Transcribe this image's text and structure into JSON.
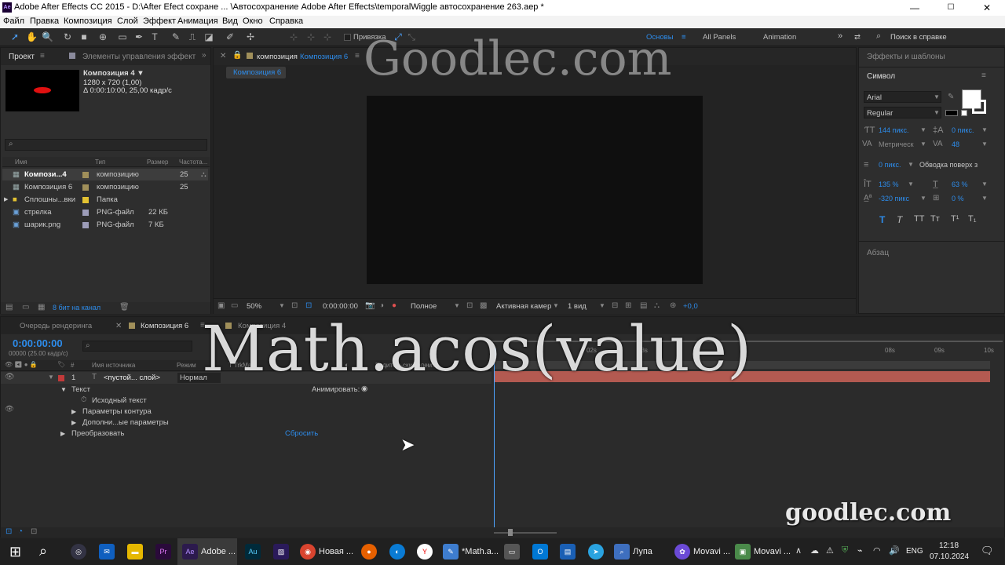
{
  "window": {
    "title": "Adobe After Effects CC 2015 - D:\\After Efect сохране ... \\Автосохранение Adobe After Effects\\temporalWiggle автосохранение 263.aep *",
    "logo": "Ae",
    "minimize": "—",
    "maximize": "☐",
    "close": "✕"
  },
  "menu": [
    "Файл",
    "Правка",
    "Композиция",
    "Слой",
    "Эффект",
    "Анимация",
    "Вид",
    "Окно",
    "Справка"
  ],
  "toolbar": {
    "snap_label": "Привязка",
    "workspaces": [
      "Основы",
      "All Panels",
      "Animation"
    ],
    "help_search": "Поиск в справке"
  },
  "project": {
    "tab": "Проект",
    "tab2": "Элементы управления эффект",
    "comp_name": "Композиция 4 ▼",
    "comp_size": "1280 x 720 (1,00)",
    "comp_duration": "Δ 0:00:10:00, 25,00 кадр/с",
    "search_placeholder": "",
    "columns": [
      "Имя",
      "Тип",
      "Размер",
      "Частота..."
    ],
    "items": [
      {
        "name": "Компози...4",
        "type": "композицию",
        "size": "",
        "rate": "25",
        "color": "#a08f5a"
      },
      {
        "name": "Композиция 6",
        "type": "композицию",
        "size": "",
        "rate": "25",
        "color": "#a08f5a"
      },
      {
        "name": "Сплошны...вки",
        "type": "Папка",
        "size": "",
        "rate": "",
        "color": "#e3c232"
      },
      {
        "name": "стрелка",
        "type": "PNG-файл",
        "size": "22 КБ",
        "rate": "",
        "color": "#9c9cb8"
      },
      {
        "name": "шарик.png",
        "type": "PNG-файл",
        "size": "7 КБ",
        "rate": "",
        "color": "#9c9cb8"
      }
    ],
    "bit_depth": "8 бит на канал"
  },
  "viewer": {
    "tab_prefix": "композиция",
    "tab_name": "Композиция 6",
    "breadcrumb": "Композиция 6",
    "zoom": "50%",
    "timecode": "0:00:00:00",
    "quality": "Полное",
    "camera": "Активная камер",
    "views": "1 вид",
    "exposure": "+0,0"
  },
  "watermark_top": "Goodlec.com",
  "watermark_bottom": "goodlec.com",
  "overlay_text": "Math.acos(value)",
  "right_panel": {
    "effects_tab": "Эффекты и шаблоны",
    "symbol_tab": "Символ",
    "font": "Arial",
    "style": "Regular",
    "size": "144 пикс.",
    "leading": "0 пикс.",
    "kerning": "Метрическ",
    "tracking": "48",
    "stroke": "0 пикс.",
    "stroke_mode": "Обводка поверх з",
    "vscale": "135 %",
    "hscale": "63 %",
    "baseline": "-320 пикс",
    "tsume": "0 %",
    "paragraph_tab": "Абзац",
    "styles": [
      "T",
      "T",
      "TT",
      "Tт",
      "T¹",
      "T₁"
    ]
  },
  "timeline": {
    "tabs": [
      "Очередь рендеринга",
      "Композиция 6",
      "Композиция 4"
    ],
    "timecode": "0:00:00:00",
    "frame_info": "00000 (25.00 кадр/с)",
    "col_source": "Имя источника",
    "col_mode": "Режим",
    "col_trkmat": "T TrkMat",
    "col_parent": "Родительский элем.",
    "layer_num": "1",
    "layer_name": "<пустой... слой>",
    "layer_mode": "Нормал",
    "text_group": "Текст",
    "animate": "Анимировать:",
    "source_text": "Исходный текст",
    "path_options": "Параметры контура",
    "more_options": "Дополни...ые параметры",
    "transform": "Преобразовать",
    "reset": "Сбросить",
    "ruler": [
      "02s",
      "03s",
      "08s",
      "09s",
      "10s"
    ]
  },
  "taskbar": {
    "apps": [
      {
        "label": "Adobe ...",
        "icon": "Ae",
        "color": "#2c1a4d"
      },
      {
        "label": "Новая ...",
        "icon": "chrome-icon",
        "color": "#d9442f"
      },
      {
        "label": "*Math.a...",
        "icon": "notepad-icon",
        "color": "#3e7dcf"
      },
      {
        "label": "Лупа",
        "icon": "magnifier-icon",
        "color": "#3e6fbf"
      },
      {
        "label": "Movavi ...",
        "icon": "movavi-icon",
        "color": "#6b4ad6"
      },
      {
        "label": "Movavi ...",
        "icon": "movavi2-icon",
        "color": "#4a8a4a"
      }
    ],
    "lang": "ENG",
    "time": "12:18",
    "date": "07.10.2024"
  }
}
